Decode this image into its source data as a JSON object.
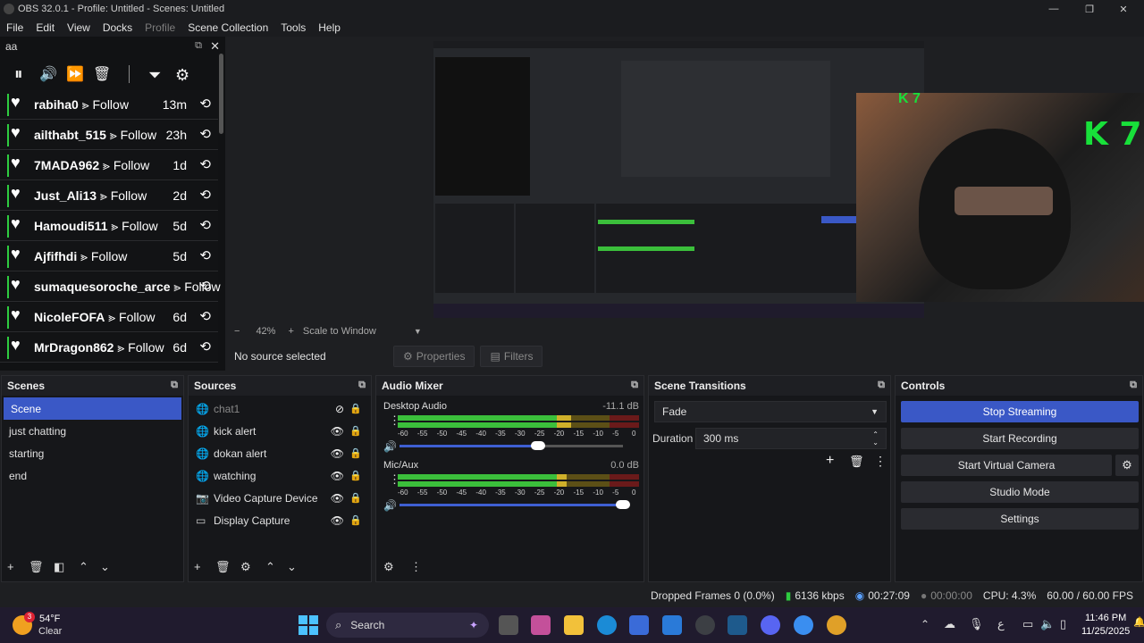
{
  "window": {
    "title": "OBS 32.0.1 - Profile: Untitled - Scenes: Untitled",
    "min": "—",
    "max": "❐",
    "close": "✕"
  },
  "menu": [
    "File",
    "Edit",
    "View",
    "Docks",
    "Profile",
    "Scene Collection",
    "Tools",
    "Help"
  ],
  "chat_dock": {
    "title": "aa",
    "undock": "⧉",
    "close": "✕",
    "toolbar": {
      "pause": "⏸",
      "sound": "🔊",
      "skip": "⏩",
      "trash": "🗑",
      "filter": "⏷",
      "settings": "⚙"
    },
    "rows": [
      {
        "user": "rabiha0",
        "action": "⪢ Follow",
        "time": "13m"
      },
      {
        "user": "ailthabt_515",
        "action": "⪢ Follow",
        "time": "23h"
      },
      {
        "user": "7MADA962",
        "action": "⪢ Follow",
        "time": "1d"
      },
      {
        "user": "Just_Ali13",
        "action": "⪢ Follow",
        "time": "2d"
      },
      {
        "user": "Hamoudi511",
        "action": "⪢ Follow",
        "time": "5d"
      },
      {
        "user": "Ajfifhdi",
        "action": "⪢ Follow",
        "time": "5d"
      },
      {
        "user": "sumaquesoroche_arce",
        "action": "⪢ Follow",
        "time": ""
      },
      {
        "user": "NicoleFOFA",
        "action": "⪢ Follow",
        "time": "6d"
      },
      {
        "user": "MrDragon862",
        "action": "⪢ Follow",
        "time": "6d"
      }
    ]
  },
  "preview": {
    "overlay_big": "K 7",
    "overlay_small": "K 7"
  },
  "zoom": {
    "minus": "−",
    "level": "42%",
    "plus": "+",
    "mode": "Scale to Window",
    "caret": "▼"
  },
  "source_bar": {
    "status": "No source selected",
    "properties": "Properties",
    "filters": "Filters"
  },
  "scenes": {
    "title": "Scenes",
    "items": [
      "Scene",
      "just chatting",
      "starting",
      "end"
    ],
    "selected": 0
  },
  "sources": {
    "title": "Sources",
    "items": [
      {
        "name": "chat1",
        "icon": "🌐",
        "visible": false
      },
      {
        "name": "kick alert",
        "icon": "🌐",
        "visible": true
      },
      {
        "name": "dokan alert",
        "icon": "🌐",
        "visible": true
      },
      {
        "name": "watching",
        "icon": "🌐",
        "visible": true
      },
      {
        "name": "Video Capture Device",
        "icon": "📷",
        "visible": true
      },
      {
        "name": "Display Capture",
        "icon": "▭",
        "visible": true
      }
    ]
  },
  "mixer": {
    "title": "Audio Mixer",
    "channels": [
      {
        "name": "Desktop Audio",
        "db": "-11.1 dB",
        "level": 0.72,
        "volume": 0.62
      },
      {
        "name": "Mic/Aux",
        "db": "0.0 dB",
        "level": 0.7,
        "volume": 1.0
      }
    ],
    "ticks": [
      "-60",
      "-55",
      "-50",
      "-45",
      "-40",
      "-35",
      "-30",
      "-25",
      "-20",
      "-15",
      "-10",
      "-5",
      "0"
    ]
  },
  "transitions": {
    "title": "Scene Transitions",
    "type": "Fade",
    "duration_label": "Duration",
    "duration": "300 ms"
  },
  "controls": {
    "title": "Controls",
    "stop_streaming": "Stop Streaming",
    "start_recording": "Start Recording",
    "start_vcam": "Start Virtual Camera",
    "studio_mode": "Studio Mode",
    "settings": "Settings"
  },
  "status": {
    "dropped": "Dropped Frames 0 (0.0%)",
    "bitrate": "6136 kbps",
    "stream_time": "00:27:09",
    "rec_time": "00:00:00",
    "cpu": "CPU: 4.3%",
    "fps": "60.00 / 60.00 FPS"
  },
  "taskbar": {
    "weather_temp": "54°F",
    "weather_desc": "Clear",
    "weather_badge": "3",
    "search": "Search",
    "time": "11:46 PM",
    "date": "11/25/2025",
    "lang": "ع"
  },
  "colors": {
    "accent": "#3a58c6",
    "follow_bar": "#2ecc40",
    "overlay": "#18e03a"
  }
}
